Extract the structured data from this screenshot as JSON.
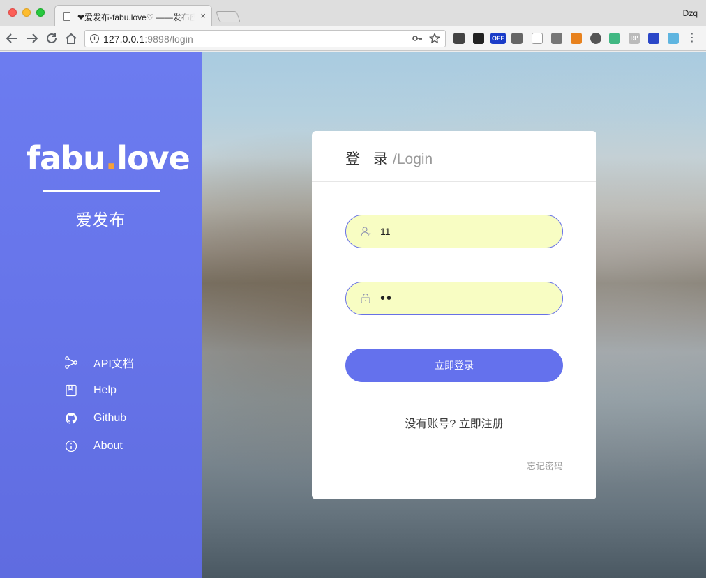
{
  "browser": {
    "tab_title": "❤爱发布-fabu.love♡ ——发布应用",
    "tab_close": "×",
    "profile": "Dzq",
    "url_host": "127.0.0.1",
    "url_rest": ":9898/login",
    "extensions": [
      "evernote-icon",
      "ghostery-icon",
      "off-badge-icon",
      "recycle-icon",
      "circle-icon",
      "lightbulb-icon",
      "metamask-fox-icon",
      "vpn-icon",
      "vue-devtools-icon",
      "rp-icon",
      "ruler-icon",
      "s-icon"
    ],
    "off_label": "OFF",
    "rp_label": "RP"
  },
  "sidebar": {
    "logo_pre": "fabu",
    "logo_dot": ".",
    "logo_post": "love",
    "tagline": "爱发布",
    "links": [
      {
        "label": "API文档",
        "icon": "share-nodes-icon"
      },
      {
        "label": "Help",
        "icon": "book-icon"
      },
      {
        "label": "Github",
        "icon": "github-icon"
      },
      {
        "label": "About",
        "icon": "info-icon"
      }
    ]
  },
  "login": {
    "title_cn": "登录",
    "title_en": "/Login",
    "username_value": "11",
    "password_value": "••",
    "submit_label": "立即登录",
    "register_text": "没有账号? 立即注册",
    "forgot_label": "忘记密码"
  },
  "colors": {
    "accent": "#6471ed",
    "sidebar": "#6775ea",
    "input_bg": "#f8fdc3",
    "logo_dot": "#f5a03a"
  }
}
